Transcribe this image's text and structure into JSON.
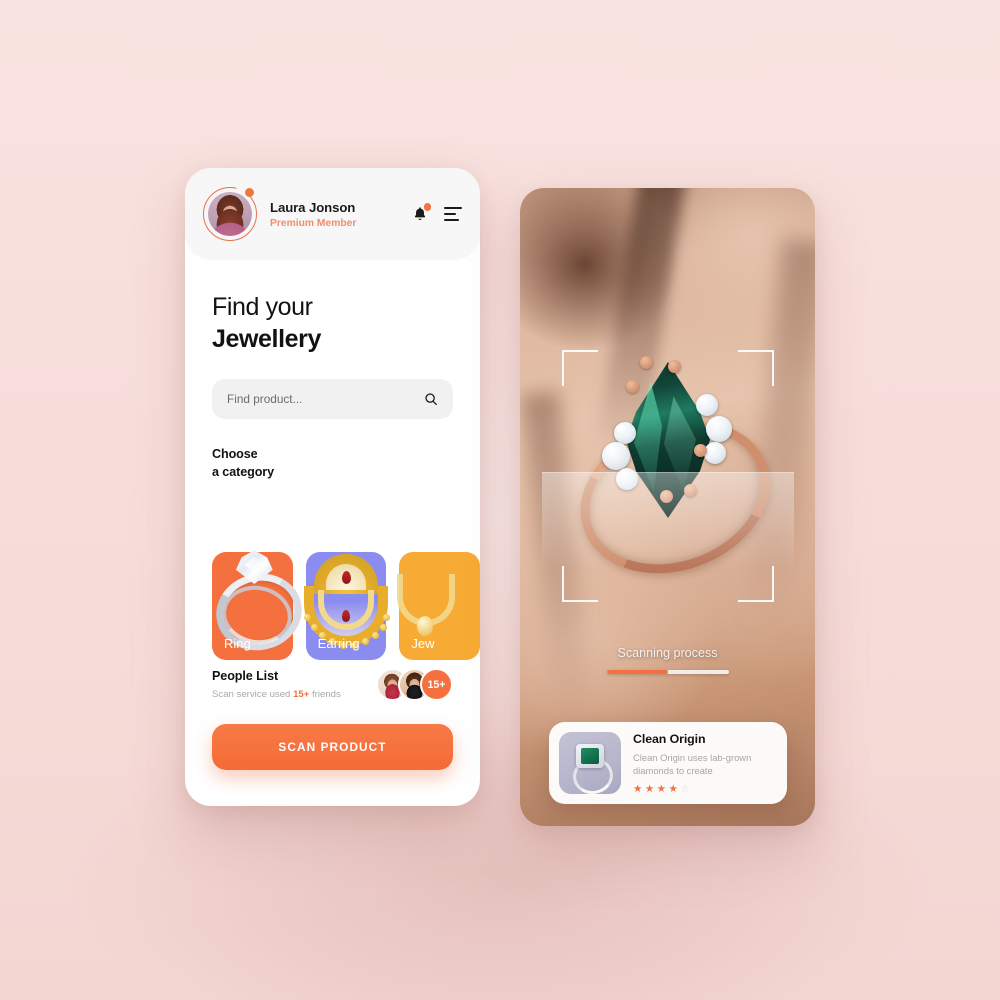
{
  "background": {
    "color": "#f7e0dd"
  },
  "theme": {
    "accent": "#f4703f",
    "accent_soft": "#ef8f6a",
    "purple": "#8b8cf0",
    "yellow": "#f7ab34",
    "text": "#121212",
    "muted": "#a9a9a9"
  },
  "left_phone": {
    "header": {
      "user_name": "Laura Jonson",
      "user_status": "Premium Member",
      "avatar_icon": "user-avatar",
      "notification_icon": "bell-icon",
      "menu_icon": "hamburger-menu-icon",
      "has_notification_badge": true
    },
    "title": {
      "line1": "Find your",
      "line2": "Jewellery"
    },
    "search": {
      "placeholder": "Find product...",
      "value": "",
      "icon": "search-icon"
    },
    "category_section": {
      "line1": "Choose",
      "line2": "a category"
    },
    "categories": [
      {
        "label": "Ring",
        "color": "#f4703f",
        "art": "ring-art"
      },
      {
        "label": "Earring",
        "color": "#8b8cf0",
        "art": "earring-art"
      },
      {
        "label": "Jew",
        "color": "#f7ab34",
        "art": "jewellery-art"
      }
    ],
    "people": {
      "title": "People List",
      "subtitle_pre": "Scan service used",
      "subtitle_count": "15+",
      "subtitle_post": "friends",
      "avatar_more_label": "15+"
    },
    "cta": {
      "label": "SCAN PRODUCT"
    }
  },
  "right_phone": {
    "camera_subject": "ring-on-finger-photo",
    "scan_frame_icon": "scan-frame-brackets",
    "status": {
      "label": "Scanning process",
      "progress_percent": 50
    },
    "product_card": {
      "thumbnail_icon": "ring-thumbnail",
      "title": "Clean Origin",
      "description": "Clean Origin uses lab-grown diamonds to create",
      "rating": 4,
      "rating_max": 5,
      "star_filled": "★",
      "star_empty": "☆"
    }
  }
}
